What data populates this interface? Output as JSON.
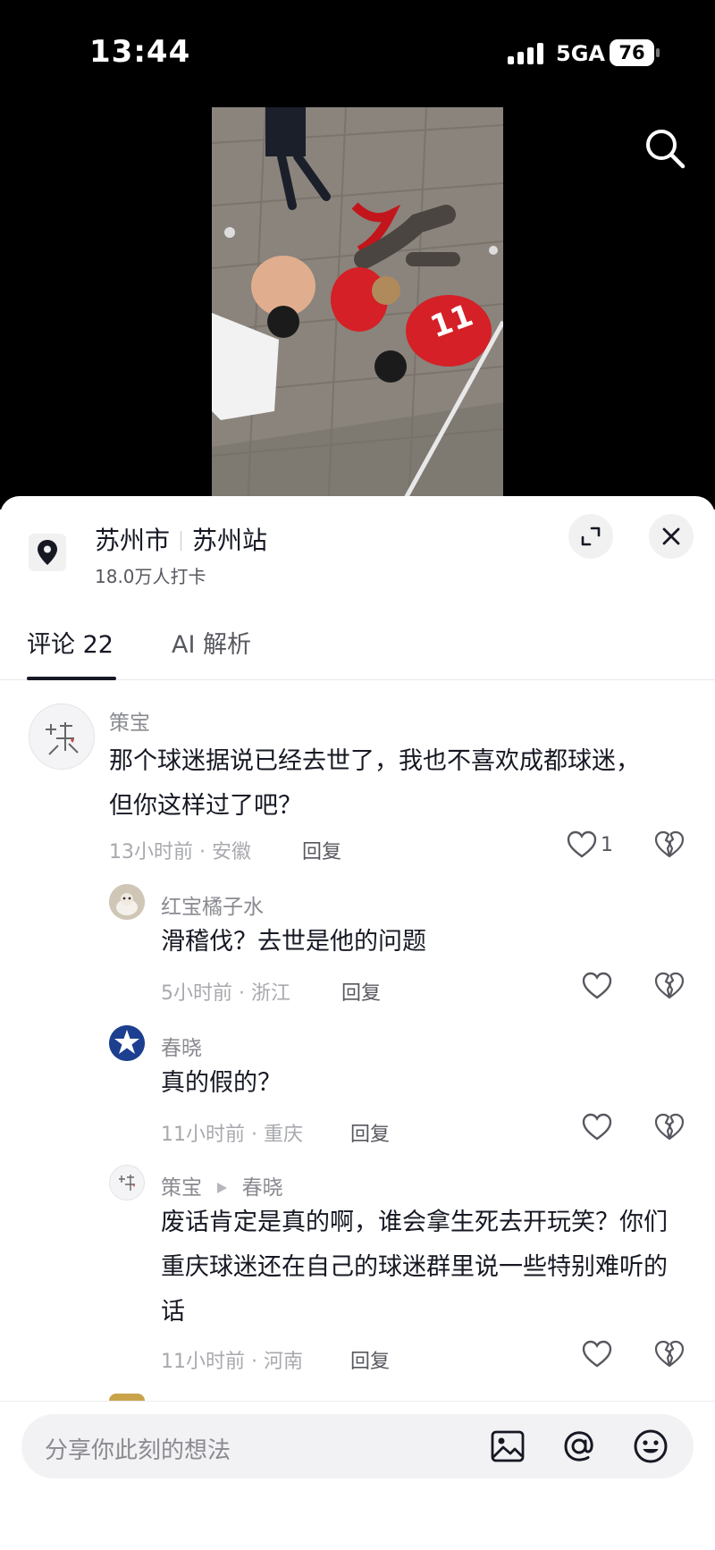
{
  "status_bar": {
    "time": "13:44",
    "network": "5GA",
    "battery": "76"
  },
  "location": {
    "title_city": "苏州市",
    "title_place": "苏州站",
    "checkins": "18.0万人打卡"
  },
  "tabs": {
    "comments": "评论 22",
    "ai": "AI 解析"
  },
  "comments": [
    {
      "user": "策宝",
      "text": "那个球迷据说已经去世了，我也不喜欢成都球迷，但你这样过了吧？",
      "meta": "13小时前 · 安徽",
      "reply": "回复",
      "likes": "1"
    },
    {
      "user": "红宝橘子水",
      "text": "滑稽伐？去世是他的问题",
      "meta": "5小时前 · 浙江",
      "reply": "回复"
    },
    {
      "user": "春晓",
      "text": "真的假的？",
      "meta": "11小时前 · 重庆",
      "reply": "回复"
    },
    {
      "user": "策宝",
      "reply_to": "春晓",
      "text": "废话肯定是真的啊，谁会拿生死去开玩笑？你们重庆球迷还在自己的球迷群里说一些特别难听的话",
      "meta": "11小时前 · 河南",
      "reply": "回复"
    }
  ],
  "input": {
    "placeholder": "分享你此刻的想法"
  },
  "colors": {
    "text_primary": "#161823",
    "text_secondary": "#8a8b91",
    "sheet_bg": "#ffffff",
    "top_bg": "#000000"
  }
}
